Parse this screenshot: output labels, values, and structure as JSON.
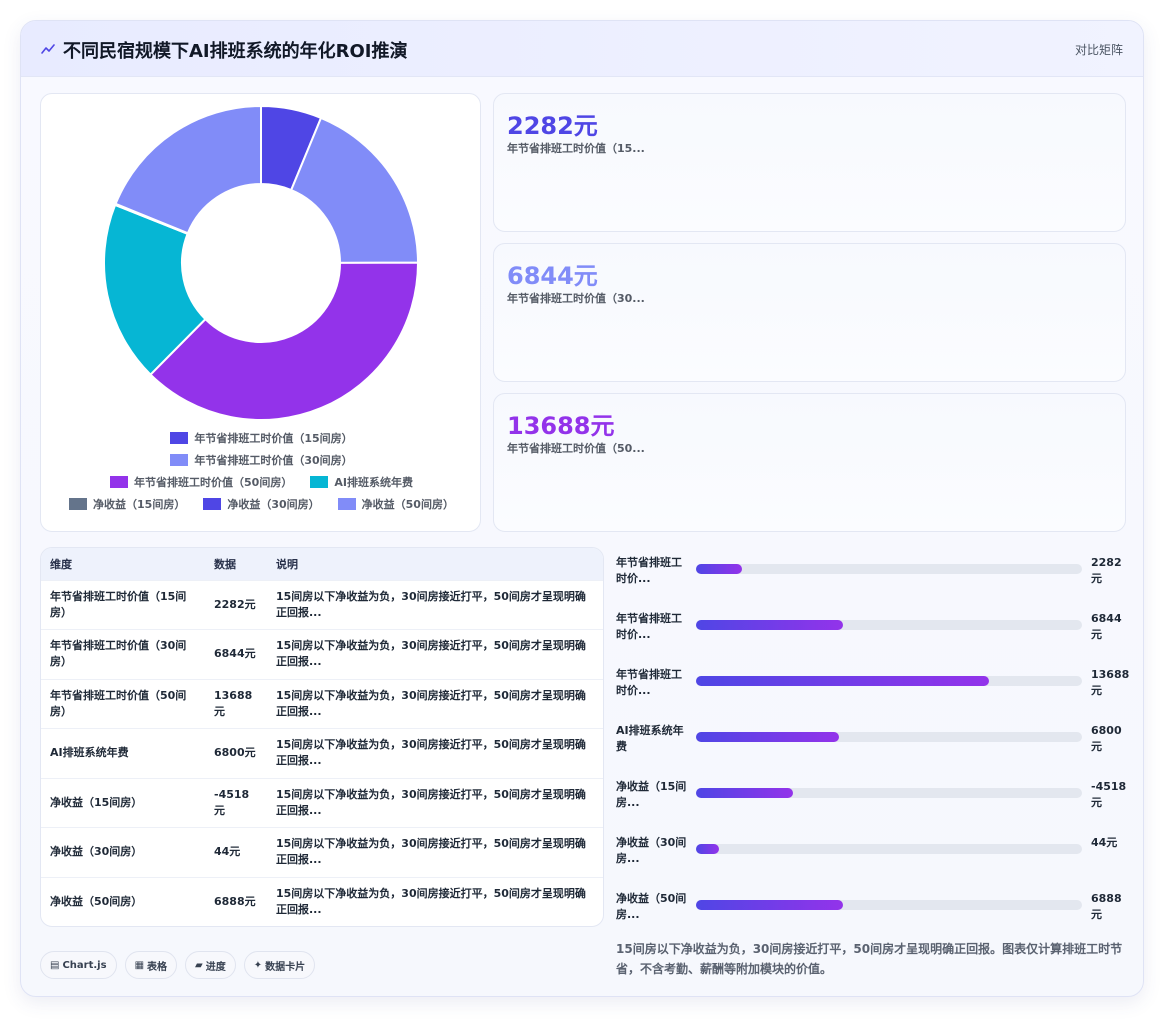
{
  "header": {
    "title": "不同民宿规模下AI排班系统的年化ROI推演",
    "badge": "对比矩阵",
    "icon": "chart-icon"
  },
  "chart_data": {
    "type": "pie",
    "categories": [
      "年节省排班工时价值（15间房）",
      "年节省排班工时价值（30间房）",
      "年节省排班工时价值（50间房）",
      "AI排班系统年费",
      "净收益（15间房）",
      "净收益（30间房）",
      "净收益（50间房）"
    ],
    "values": [
      2282,
      6844,
      13688,
      6800,
      -4518,
      44,
      6888
    ],
    "colors": [
      "#4f46e5",
      "#818cf8",
      "#9333ea",
      "#06b6d4",
      "#64748b",
      "#4f46e5",
      "#818cf8"
    ],
    "legend_position": "bottom"
  },
  "stats": [
    {
      "value": "2282元",
      "label": "年节省排班工时价值（15...",
      "color": "#4f46e5"
    },
    {
      "value": "6844元",
      "label": "年节省排班工时价值（30...",
      "color": "#818cf8"
    },
    {
      "value": "13688元",
      "label": "年节省排班工时价值（50...",
      "color": "#9333ea"
    }
  ],
  "table": {
    "headers": [
      "维度",
      "数据",
      "说明"
    ],
    "rows": [
      {
        "dim": "年节省排班工时价值（15间房）",
        "val": "2282元",
        "desc": "15间房以下净收益为负，30间房接近打平，50间房才呈现明确正回报..."
      },
      {
        "dim": "年节省排班工时价值（30间房）",
        "val": "6844元",
        "desc": "15间房以下净收益为负，30间房接近打平，50间房才呈现明确正回报..."
      },
      {
        "dim": "年节省排班工时价值（50间房）",
        "val": "13688元",
        "desc": "15间房以下净收益为负，30间房接近打平，50间房才呈现明确正回报..."
      },
      {
        "dim": "AI排班系统年费",
        "val": "6800元",
        "desc": "15间房以下净收益为负，30间房接近打平，50间房才呈现明确正回报..."
      },
      {
        "dim": "净收益（15间房）",
        "val": "-4518元",
        "desc": "15间房以下净收益为负，30间房接近打平，50间房才呈现明确正回报..."
      },
      {
        "dim": "净收益（30间房）",
        "val": "44元",
        "desc": "15间房以下净收益为负，30间房接近打平，50间房才呈现明确正回报..."
      },
      {
        "dim": "净收益（50间房）",
        "val": "6888元",
        "desc": "15间房以下净收益为负，30间房接近打平，50间房才呈现明确正回报..."
      }
    ]
  },
  "progress": [
    {
      "label": "年节省排班工时价...",
      "value": "2282元",
      "fraction": 0.12
    },
    {
      "label": "年节省排班工时价...",
      "value": "6844元",
      "fraction": 0.38
    },
    {
      "label": "年节省排班工时价...",
      "value": "13688元",
      "fraction": 0.76
    },
    {
      "label": "AI排班系统年费",
      "value": "6800元",
      "fraction": 0.37
    },
    {
      "label": "净收益（15间房...",
      "value": "-4518元",
      "fraction": 0.25
    },
    {
      "label": "净收益（30间房...",
      "value": "44元",
      "fraction": 0.06
    },
    {
      "label": "净收益（50间房...",
      "value": "6888元",
      "fraction": 0.38
    }
  ],
  "chips": [
    {
      "glyph": "▤",
      "label": "Chart.js"
    },
    {
      "glyph": "▦",
      "label": "表格"
    },
    {
      "glyph": "▰",
      "label": "进度"
    },
    {
      "glyph": "✦",
      "label": "数据卡片"
    }
  ],
  "note": "15间房以下净收益为负，30间房接近打平，50间房才呈现明确正回报。图表仅计算排班工时节省，不含考勤、薪酬等附加模块的价值。"
}
